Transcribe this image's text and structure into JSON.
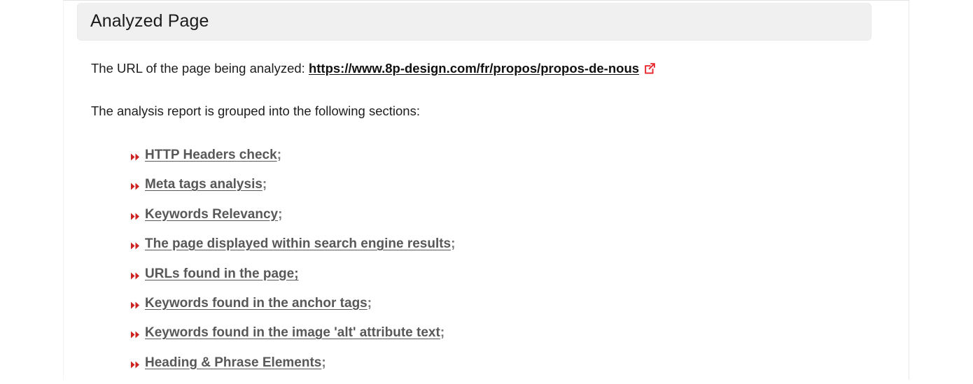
{
  "panel": {
    "heading": "Analyzed Page",
    "intro": {
      "url_prefix": "The URL of the page being analyzed: ",
      "url_text": "https://www.8p-design.com/fr/propos/propos-de-nous",
      "external_icon": "external-link-icon",
      "sections_intro": "The analysis report is grouped into the following sections:"
    },
    "sections": [
      {
        "label": "HTTP Headers check",
        "suffix": ";",
        "suffix_underlined": false
      },
      {
        "label": "Meta tags analysis",
        "suffix": ";",
        "suffix_underlined": false
      },
      {
        "label": "Keywords Relevancy",
        "suffix": ";",
        "suffix_underlined": false
      },
      {
        "label": "The page displayed within search engine results",
        "suffix": ";",
        "suffix_underlined": false
      },
      {
        "label": "URLs found in the page;",
        "suffix": "",
        "suffix_underlined": true
      },
      {
        "label": "Keywords found in the anchor tags",
        "suffix": ";",
        "suffix_underlined": false
      },
      {
        "label": "Keywords found in the image 'alt' attribute text",
        "suffix": ";",
        "suffix_underlined": false
      },
      {
        "label": "Heading & Phrase Elements",
        "suffix": ";",
        "suffix_underlined": false
      }
    ],
    "bullet_glyph": "double-chevron-right-icon"
  },
  "colors": {
    "bullet_red": "#cc2222",
    "external_icon_red": "#e8252a",
    "link_gray": "#585858",
    "heading_bg": "#f0f0f0",
    "heading_text": "#1b1b1b"
  }
}
